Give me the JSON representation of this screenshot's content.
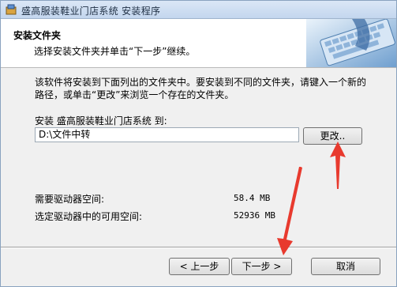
{
  "window": {
    "title": "盛高服装鞋业门店系统 安装程序"
  },
  "header": {
    "title": "安装文件夹",
    "subtitle": "选择安装文件夹并单击“下一步”继续。"
  },
  "body": {
    "description": "该软件将安装到下面列出的文件夹中。要安装到不同的文件夹，请键入一个新的路径，或单击“更改”来浏览一个存在的文件夹。",
    "install_label": "安装 盛高服装鞋业门店系统 到:",
    "install_path": "D:\\文件中转",
    "browse_label": "更改..",
    "required_space_label": "需要驱动器空间:",
    "required_space_value": "58.4 MB",
    "available_space_label": "选定驱动器中的可用空间:",
    "available_space_value": "52936 MB"
  },
  "footer": {
    "back_label": "< 上一步",
    "next_label": "下一步 >",
    "cancel_label": "取消"
  },
  "colors": {
    "annotation_arrow": "#e83a2e",
    "header_bg": "#ffffff"
  },
  "icons": {
    "app": "installer-icon",
    "header_art": "keyboard-image"
  }
}
